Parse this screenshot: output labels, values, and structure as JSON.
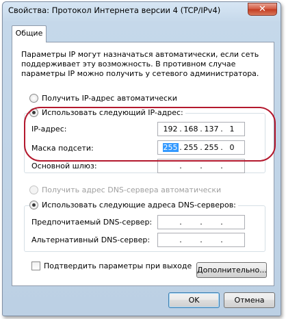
{
  "window": {
    "title": "Свойства: Протокол Интернета версии 4 (TCP/IPv4)",
    "close_label": "✕"
  },
  "tabs": [
    {
      "label": "Общие",
      "selected": true
    }
  ],
  "description": "Параметры IP могут назначаться автоматически, если сеть поддерживает эту возможность. В противном случае параметры IP можно получить у сетевого администратора.",
  "ip_section": {
    "auto_radio_label": "Получить IP-адрес автоматически",
    "auto_selected": false,
    "manual_radio_label": "Использовать следующий IP-адрес:",
    "manual_selected": true,
    "ip_address": {
      "label": "IP-адрес:",
      "octets": [
        "192",
        "168",
        "137",
        "1"
      ]
    },
    "subnet_mask": {
      "label": "Маска подсети:",
      "octets": [
        "255",
        "255",
        "255",
        "0"
      ],
      "selected_octet": 0
    },
    "gateway": {
      "label": "Основной шлюз:",
      "octets": [
        "",
        "",
        "",
        ""
      ]
    }
  },
  "dns_section": {
    "auto_radio_label": "Получить адрес DNS-сервера автоматически",
    "auto_disabled": true,
    "manual_radio_label": "Использовать следующие адреса DNS-серверов:",
    "manual_selected": true,
    "preferred": {
      "label": "Предпочитаемый DNS-сервер:",
      "octets": [
        "",
        "",
        "",
        ""
      ]
    },
    "alternate": {
      "label": "Альтернативный DNS-сервер:",
      "octets": [
        "",
        "",
        "",
        ""
      ]
    }
  },
  "validate_checkbox": {
    "label": "Подтвердить параметры при выходе",
    "checked": false
  },
  "buttons": {
    "advanced": "Дополнительно...",
    "ok": "OK",
    "cancel": "Отмена"
  },
  "colors": {
    "annotation_ellipse": "#b3182d",
    "selection": "#3399ff"
  }
}
